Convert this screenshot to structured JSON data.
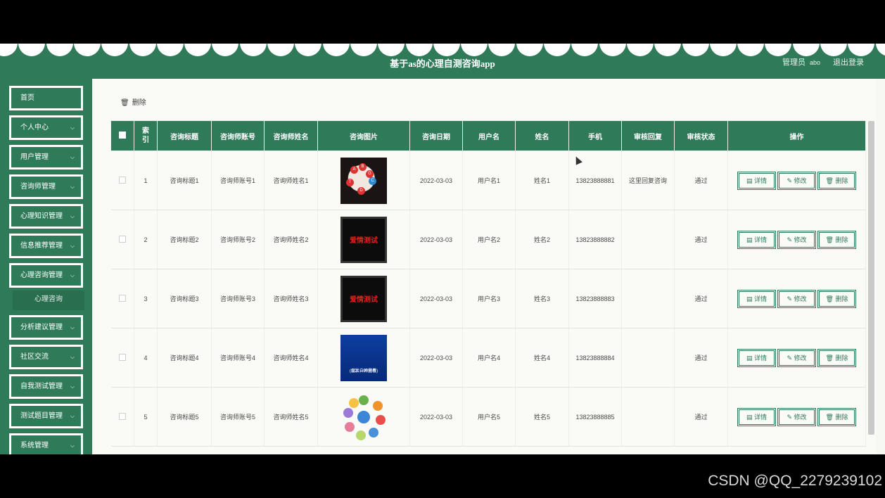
{
  "header": {
    "title": "基于as的心理自测咨询app",
    "role_label": "管理员",
    "username": "abo",
    "logout_label": "退出登录"
  },
  "sidebar": {
    "items": [
      {
        "label": "首页",
        "has_arrow": false
      },
      {
        "label": "个人中心",
        "has_arrow": true
      },
      {
        "label": "用户管理",
        "has_arrow": true
      },
      {
        "label": "咨询师管理",
        "has_arrow": true
      },
      {
        "label": "心理知识管理",
        "has_arrow": true
      },
      {
        "label": "信息推荐管理",
        "has_arrow": true
      },
      {
        "label": "心理咨询管理",
        "has_arrow": true
      },
      {
        "label": "分析建议管理",
        "has_arrow": true
      },
      {
        "label": "社区交流",
        "has_arrow": true
      },
      {
        "label": "自我测试管理",
        "has_arrow": true
      },
      {
        "label": "测试题目管理",
        "has_arrow": true
      },
      {
        "label": "系统管理",
        "has_arrow": true
      }
    ],
    "active_submenu": "心理咨询",
    "arrow_icon": "chevron-down-icon"
  },
  "toolbar": {
    "delete_label": "删除",
    "delete_icon": "trash-icon"
  },
  "table": {
    "headers": [
      "",
      "索引",
      "咨询标题",
      "咨询师账号",
      "咨询师姓名",
      "咨询图片",
      "咨询日期",
      "用户名",
      "姓名",
      "手机",
      "审核回复",
      "审核状态",
      "操作"
    ],
    "rows": [
      {
        "index": "1",
        "title": "咨询标题1",
        "account": "咨询师账号1",
        "name": "咨询师姓名1",
        "date": "2022-03-03",
        "username": "用户名1",
        "realname": "姓名1",
        "phone": "13823888881",
        "reply": "这里回复咨询",
        "status": "通过"
      },
      {
        "index": "2",
        "title": "咨询标题2",
        "account": "咨询师账号2",
        "name": "咨询师姓名2",
        "date": "2022-03-03",
        "username": "用户名2",
        "realname": "姓名2",
        "phone": "13823888882",
        "reply": "",
        "status": "通过"
      },
      {
        "index": "3",
        "title": "咨询标题3",
        "account": "咨询师账号3",
        "name": "咨询师姓名3",
        "date": "2022-03-03",
        "username": "用户名3",
        "realname": "姓名3",
        "phone": "13823888883",
        "reply": "",
        "status": "通过"
      },
      {
        "index": "4",
        "title": "咨询标题4",
        "account": "咨询师账号4",
        "name": "咨询师姓名4",
        "date": "2022-03-03",
        "username": "用户名4",
        "realname": "姓名4",
        "phone": "13823888884",
        "reply": "",
        "status": "通过"
      },
      {
        "index": "5",
        "title": "咨询标题5",
        "account": "咨询师账号5",
        "name": "咨询师姓名5",
        "date": "2022-03-03",
        "username": "用户名5",
        "realname": "姓名5",
        "phone": "13823888885",
        "reply": "",
        "status": "通过"
      }
    ],
    "image_texts": {
      "love_test": "爱情测试",
      "scale_line1": "症状自评量表",
      "scale_line2": "(SCL—90问卷)"
    },
    "actions": {
      "detail": "详情",
      "edit": "修改",
      "delete": "删除"
    }
  },
  "watermark": "CSDN @QQ_2279239102",
  "colors": {
    "primary": "#2f7a59",
    "background": "#fafaf7"
  }
}
